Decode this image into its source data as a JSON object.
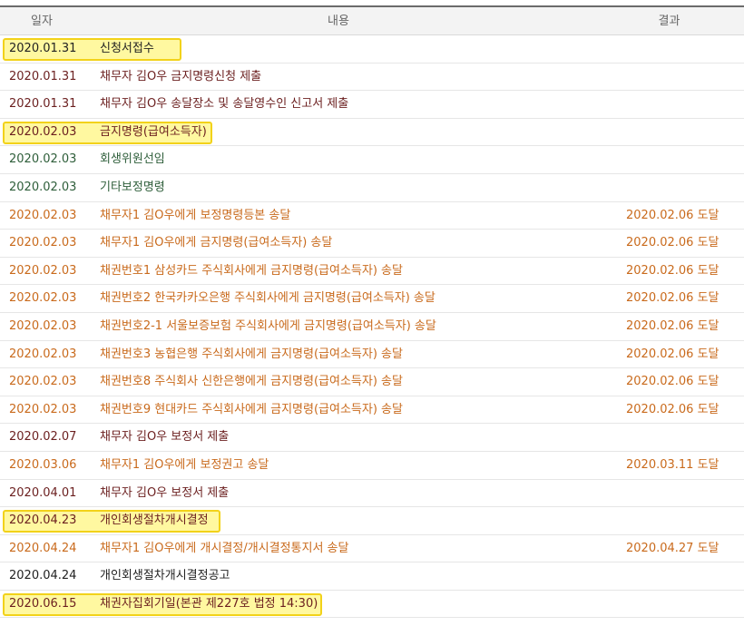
{
  "header": {
    "date": "일자",
    "content": "내용",
    "result": "결과"
  },
  "rows": [
    {
      "date": "2020.01.31",
      "content": "신청서접수",
      "result": "",
      "color": "black",
      "highlight": true,
      "hlWidth": 197
    },
    {
      "date": "2020.01.31",
      "content": "채무자 김O우 금지명령신청 제출",
      "result": "",
      "color": "maroon",
      "highlight": false
    },
    {
      "date": "2020.01.31",
      "content": "채무자 김O우 송달장소 및 송달영수인 신고서 제출",
      "result": "",
      "color": "maroon",
      "highlight": false
    },
    {
      "date": "2020.02.03",
      "content": "금지명령(급여소득자)",
      "result": "",
      "color": "maroon",
      "highlight": true,
      "hlWidth": 231
    },
    {
      "date": "2020.02.03",
      "content": "회생위원선임",
      "result": "",
      "color": "green",
      "highlight": false
    },
    {
      "date": "2020.02.03",
      "content": "기타보정명령",
      "result": "",
      "color": "green",
      "highlight": false
    },
    {
      "date": "2020.02.03",
      "content": "채무자1 김O우에게 보정명령등본 송달",
      "result": "2020.02.06 도달",
      "color": "orange",
      "highlight": false
    },
    {
      "date": "2020.02.03",
      "content": "채무자1 김O우에게 금지명령(급여소득자) 송달",
      "result": "2020.02.06 도달",
      "color": "orange",
      "highlight": false
    },
    {
      "date": "2020.02.03",
      "content": "채권번호1 삼성카드 주식회사에게 금지명령(급여소득자) 송달",
      "result": "2020.02.06 도달",
      "color": "orange",
      "highlight": false
    },
    {
      "date": "2020.02.03",
      "content": "채권번호2 한국카카오은행 주식회사에게 금지명령(급여소득자) 송달",
      "result": "2020.02.06 도달",
      "color": "orange",
      "highlight": false
    },
    {
      "date": "2020.02.03",
      "content": "채권번호2-1 서울보증보험 주식회사에게 금지명령(급여소득자) 송달",
      "result": "2020.02.06 도달",
      "color": "orange",
      "highlight": false
    },
    {
      "date": "2020.02.03",
      "content": "채권번호3 농협은행 주식회사에게 금지명령(급여소득자) 송달",
      "result": "2020.02.06 도달",
      "color": "orange",
      "highlight": false
    },
    {
      "date": "2020.02.03",
      "content": "채권번호8 주식회사 신한은행에게 금지명령(급여소득자) 송달",
      "result": "2020.02.06 도달",
      "color": "orange",
      "highlight": false
    },
    {
      "date": "2020.02.03",
      "content": "채권번호9 현대카드 주식회사에게 금지명령(급여소득자) 송달",
      "result": "2020.02.06 도달",
      "color": "orange",
      "highlight": false
    },
    {
      "date": "2020.02.07",
      "content": "채무자 김O우 보정서 제출",
      "result": "",
      "color": "maroon",
      "highlight": false
    },
    {
      "date": "2020.03.06",
      "content": "채무자1 김O우에게 보정권고 송달",
      "result": "2020.03.11 도달",
      "color": "orange",
      "highlight": false
    },
    {
      "date": "2020.04.01",
      "content": "채무자 김O우 보정서 제출",
      "result": "",
      "color": "maroon",
      "highlight": false
    },
    {
      "date": "2020.04.23",
      "content": "개인회생절차개시결정",
      "result": "",
      "color": "maroon",
      "highlight": true,
      "hlWidth": 240
    },
    {
      "date": "2020.04.24",
      "content": "채무자1 김O우에게 개시결정/개시결정통지서 송달",
      "result": "2020.04.27 도달",
      "color": "orange",
      "highlight": false
    },
    {
      "date": "2020.04.24",
      "content": "개인회생절차개시결정공고",
      "result": "",
      "color": "black",
      "highlight": false
    },
    {
      "date": "2020.06.15",
      "content": "채권자집회기일(본관 제227호 법정 14:30)",
      "result": "",
      "color": "maroon",
      "highlight": true,
      "hlWidth": 352
    }
  ]
}
